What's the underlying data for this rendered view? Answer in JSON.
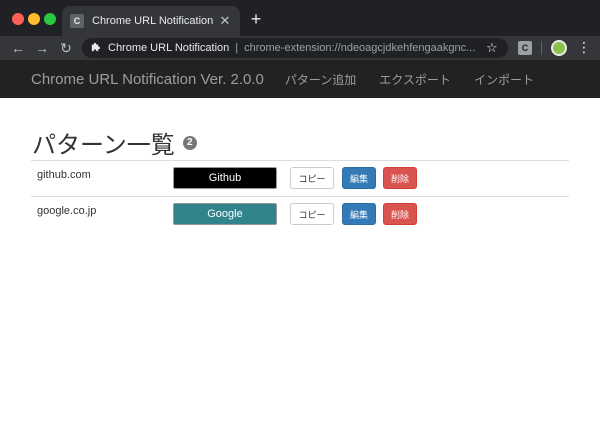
{
  "browser": {
    "tab": {
      "favicon_letter": "C",
      "title": "Chrome URL Notification",
      "close_glyph": "✕"
    },
    "new_tab_glyph": "+",
    "nav": {
      "back_glyph": "←",
      "forward_glyph": "→",
      "reload_glyph": "↻"
    },
    "omnibox": {
      "site_name": "Chrome URL Notification",
      "separator": "|",
      "url": "chrome-extension://ndeoagcjdkehfengaakgnc..."
    },
    "star_glyph": "☆",
    "extension_letter": "C",
    "menu_glyph": "⋮"
  },
  "navbar": {
    "brand": "Chrome URL Notification  Ver. 2.0.0",
    "links": [
      "パターン追加",
      "エクスポート",
      "インポート"
    ]
  },
  "page": {
    "title": "パターン一覧",
    "count": "2"
  },
  "patterns": [
    {
      "url": "github.com",
      "message": "Github",
      "bg_color": "#000000",
      "text_color": "#ffffff"
    },
    {
      "url": "google.co.jp",
      "message": "Google",
      "bg_color": "#31848c",
      "text_color": "#ffffff"
    }
  ],
  "actions": {
    "copy": "コピー",
    "edit": "編集",
    "delete": "削除"
  },
  "colors": {
    "navbar_bg": "#222222",
    "edit": "#337ab7",
    "delete": "#d9534f"
  }
}
